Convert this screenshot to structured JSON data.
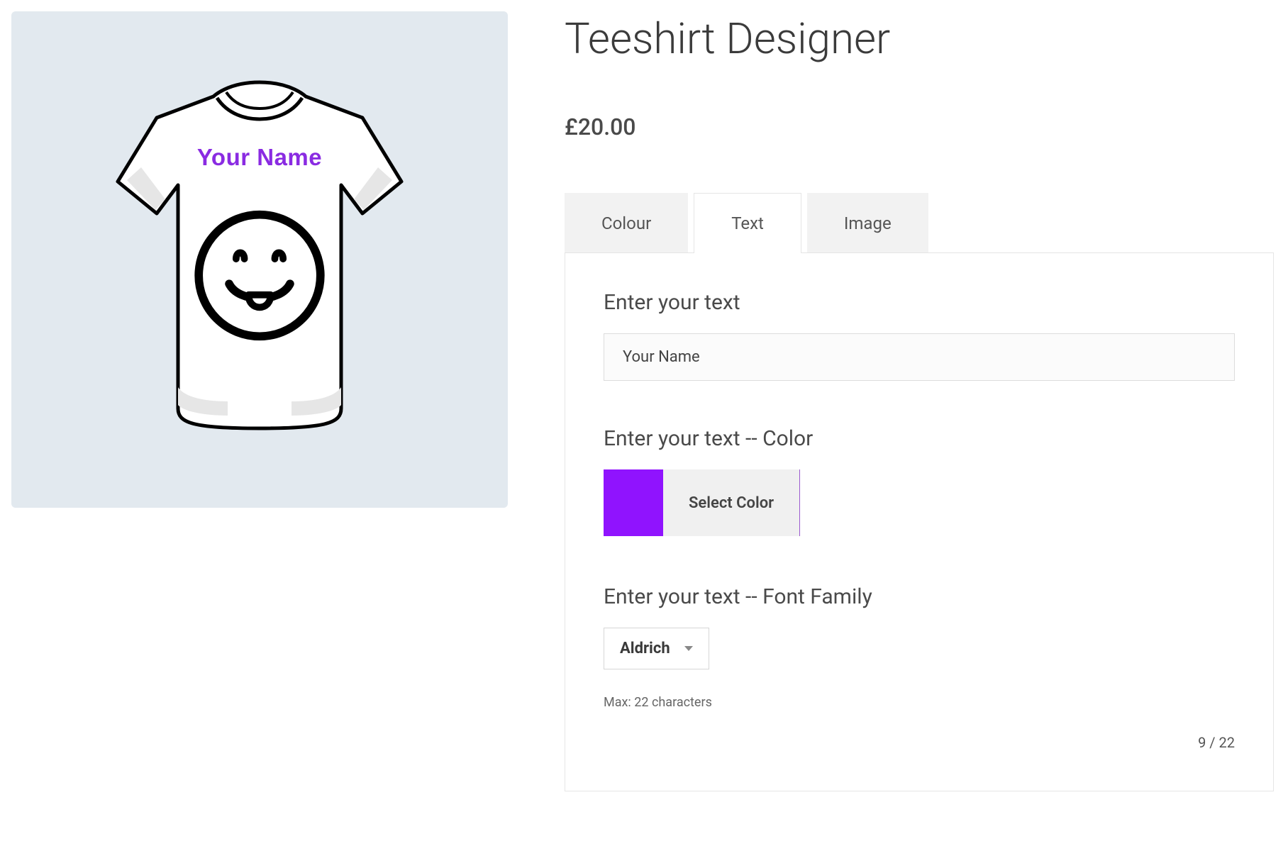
{
  "product": {
    "title": "Teeshirt Designer",
    "price": "£20.00"
  },
  "tabs": {
    "items": [
      {
        "label": "Colour",
        "active": false
      },
      {
        "label": "Text",
        "active": true
      },
      {
        "label": "Image",
        "active": false
      }
    ]
  },
  "textPanel": {
    "enterText": {
      "label": "Enter your text",
      "value": "Your Name"
    },
    "color": {
      "label": "Enter your text -- Color",
      "button": "Select Color",
      "swatch": "#9013fe"
    },
    "font": {
      "label": "Enter your text -- Font Family",
      "selected": "Aldrich"
    },
    "hint": "Max: 22 characters",
    "counter": "9 / 22"
  },
  "preview": {
    "text": "Your Name",
    "textColor": "#8a2be2"
  }
}
